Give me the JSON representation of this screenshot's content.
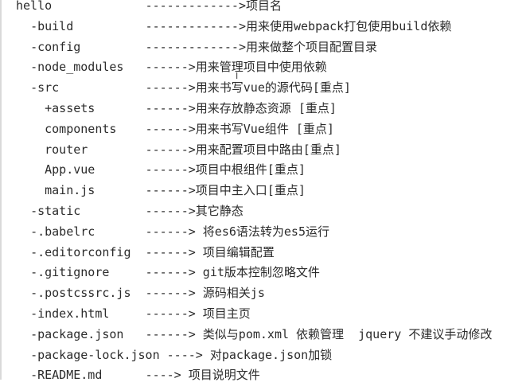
{
  "lines": [
    {
      "indent": "",
      "name": "hello",
      "arrow": "------------->",
      "desc": "项目名"
    },
    {
      "indent": "  ",
      "name": "-build",
      "arrow": "------------->",
      "desc": "用来使用webpack打包使用build依赖"
    },
    {
      "indent": "  ",
      "name": "-config",
      "arrow": "------------->",
      "desc": "用来做整个项目配置目录"
    },
    {
      "indent": "  ",
      "name": "-node_modules",
      "arrow": "------>",
      "desc": "用来管理项目中使用依赖"
    },
    {
      "indent": "  ",
      "name": "-src",
      "arrow": "------>",
      "desc": "用来书写vue的源代码[重点]"
    },
    {
      "indent": "    ",
      "name": "+assets",
      "arrow": "------>",
      "desc": "用来存放静态资源 [重点]"
    },
    {
      "indent": "    ",
      "name": "components",
      "arrow": "------>",
      "desc": "用来书写Vue组件 [重点]"
    },
    {
      "indent": "    ",
      "name": "router",
      "arrow": "------>",
      "desc": "用来配置项目中路由[重点]"
    },
    {
      "indent": "    ",
      "name": "App.vue",
      "arrow": "------>",
      "desc": "项目中根组件[重点]"
    },
    {
      "indent": "    ",
      "name": "main.js",
      "arrow": "------>",
      "desc": "项目中主入口[重点]"
    },
    {
      "indent": "  ",
      "name": "-static",
      "arrow": "------>",
      "desc": "其它静态"
    },
    {
      "indent": "  ",
      "name": "-.babelrc",
      "arrow": "------>",
      "desc": " 将es6语法转为es5运行"
    },
    {
      "indent": "  ",
      "name": "-.editorconfig",
      "arrow": "------>",
      "desc": " 项目编辑配置"
    },
    {
      "indent": "  ",
      "name": "-.gitignore",
      "arrow": "------>",
      "desc": " git版本控制忽略文件"
    },
    {
      "indent": "  ",
      "name": "-.postcssrc.js",
      "arrow": "------>",
      "desc": " 源码相关js"
    },
    {
      "indent": "  ",
      "name": "-index.html",
      "arrow": "------>",
      "desc": " 项目主页"
    },
    {
      "indent": "  ",
      "name": "-package.json",
      "arrow": "------>",
      "desc": " 类似与pom.xml 依赖管理  jquery 不建议手动修改"
    },
    {
      "indent": "  ",
      "name": "-package-lock.json",
      "arrow": "---->",
      "desc": " 对package.json加锁"
    },
    {
      "indent": "  ",
      "name": "-README.md",
      "arrow": "---->",
      "desc": " 项目说明文件"
    }
  ],
  "cursor_glyph": "I"
}
